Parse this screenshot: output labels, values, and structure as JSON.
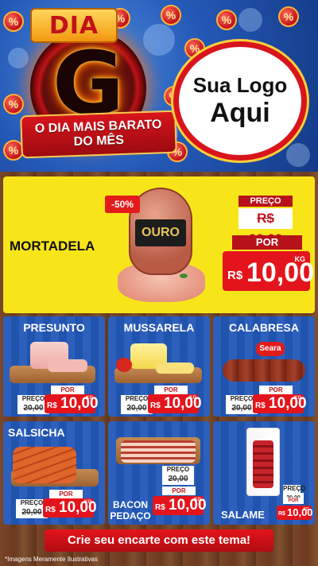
{
  "header": {
    "badge": "DIA",
    "big_letter": "G",
    "slogan": "O DIA MAIS BARATO DO MÊS",
    "logo_line1": "Sua Logo",
    "logo_line2": "Aqui",
    "coin_icon": "%"
  },
  "featured": {
    "name": "MORTADELA",
    "discount": "-50%",
    "brand": "OURO",
    "old_label": "PREÇO",
    "old_price": "R$ 20,00",
    "new_label": "POR",
    "currency": "R$",
    "new_price": "10,00",
    "unit": "KG"
  },
  "products": [
    {
      "name": "PRESUNTO",
      "old_label": "PREÇO",
      "old_price": "20,00",
      "new_label": "POR",
      "currency": "R$",
      "price": "10,00",
      "unit": "KG"
    },
    {
      "name": "MUSSARELA",
      "old_label": "PREÇO",
      "old_price": "20,00",
      "new_label": "POR",
      "currency": "R$",
      "price": "10,00",
      "unit": "KG"
    },
    {
      "name": "CALABRESA",
      "brand": "Seara",
      "old_label": "PREÇO",
      "old_price": "20,00",
      "new_label": "POR",
      "currency": "R$",
      "price": "10,00",
      "unit": "KG"
    },
    {
      "name": "SALSICHA",
      "old_label": "PREÇO",
      "old_price": "20,00",
      "new_label": "POR",
      "currency": "R$",
      "price": "10,00",
      "unit": "KG"
    },
    {
      "name": "BACON PEDAÇO",
      "old_label": "PREÇO",
      "old_price": "20,00",
      "new_label": "POR",
      "currency": "R$",
      "price": "10,00",
      "unit": "KG"
    },
    {
      "name": "SALAME",
      "old_label": "PREÇO",
      "old_price": "20,00",
      "new_label": "POR",
      "currency": "R$",
      "price": "10,00",
      "unit": "KG"
    }
  ],
  "footer": {
    "cta": "Crie seu encarte com este tema!",
    "note": "*Imagens Meramente Ilustrativas"
  },
  "colors": {
    "brand_red": "#e4141c",
    "panel_blue": "#2258b8",
    "featured_yellow": "#f7e51a",
    "gold": "#ffcf3a"
  }
}
